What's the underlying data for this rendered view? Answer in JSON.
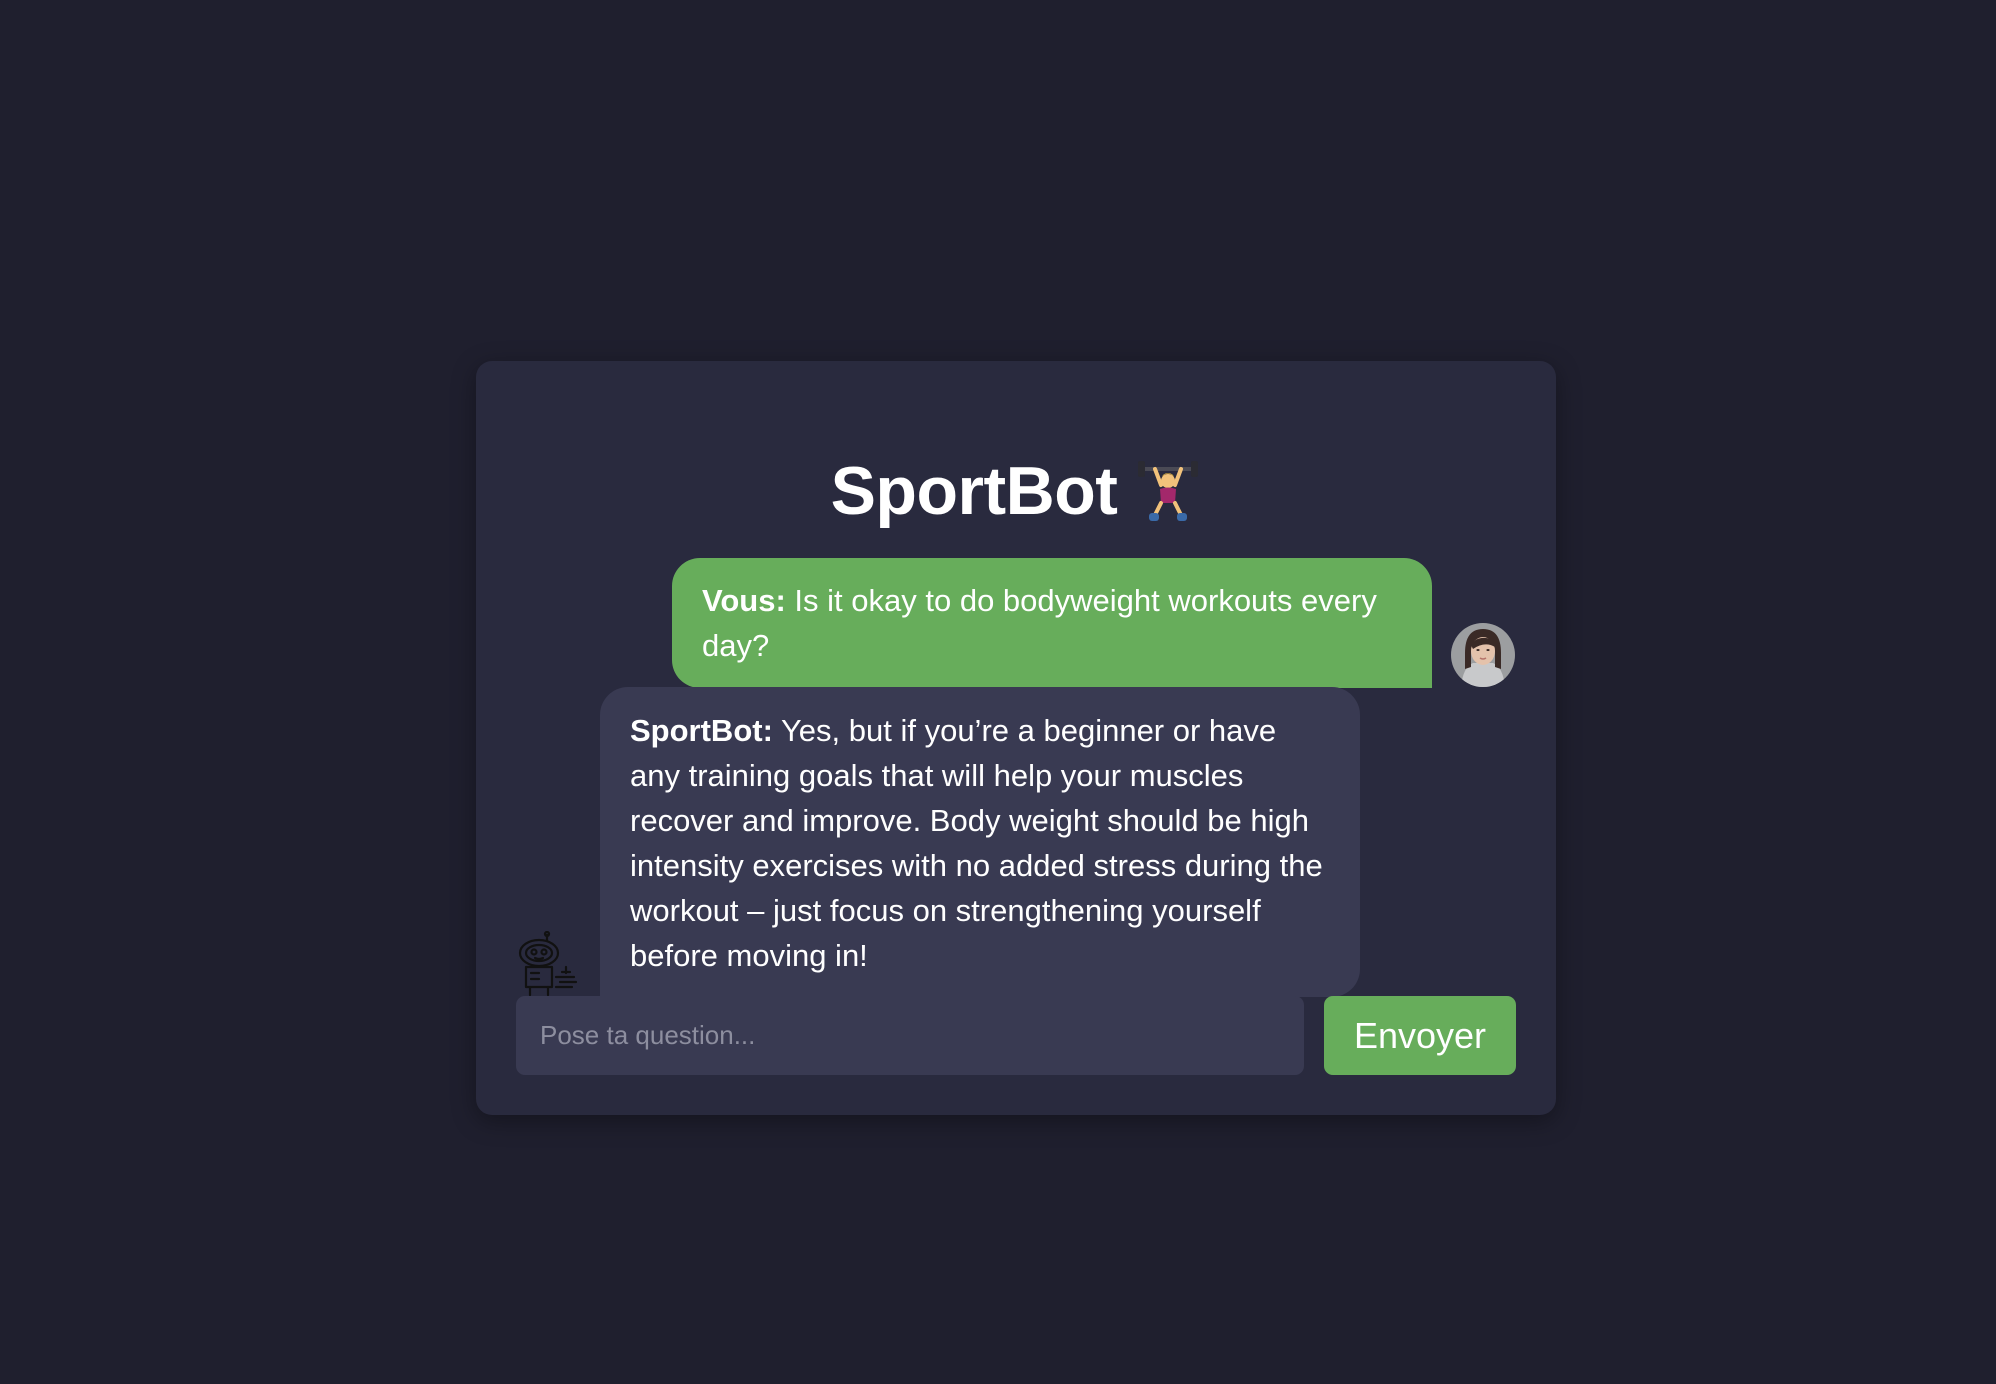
{
  "app": {
    "title": "SportBot",
    "title_icon": "weightlifter-icon"
  },
  "messages": [
    {
      "role": "user",
      "sender": "Vous:",
      "text": " Is it okay to do bodyweight workouts every day?",
      "avatar": "user-avatar-photo"
    },
    {
      "role": "bot",
      "sender": "SportBot:",
      "text": " Yes, but if you’re a beginner or have any training goals that will help your muscles recover and improve. Body weight should be high intensity exercises with no added stress during the workout – just focus on strengthening yourself before moving in!",
      "avatar": "robot-icon"
    }
  ],
  "composer": {
    "placeholder": "Pose ta question...",
    "value": "",
    "send_label": "Envoyer"
  },
  "colors": {
    "page_bg": "#1f1f2e",
    "card_bg": "#292a3e",
    "user_bubble": "#67ad5b",
    "bot_bubble": "#393a52",
    "accent": "#67ad5b"
  }
}
